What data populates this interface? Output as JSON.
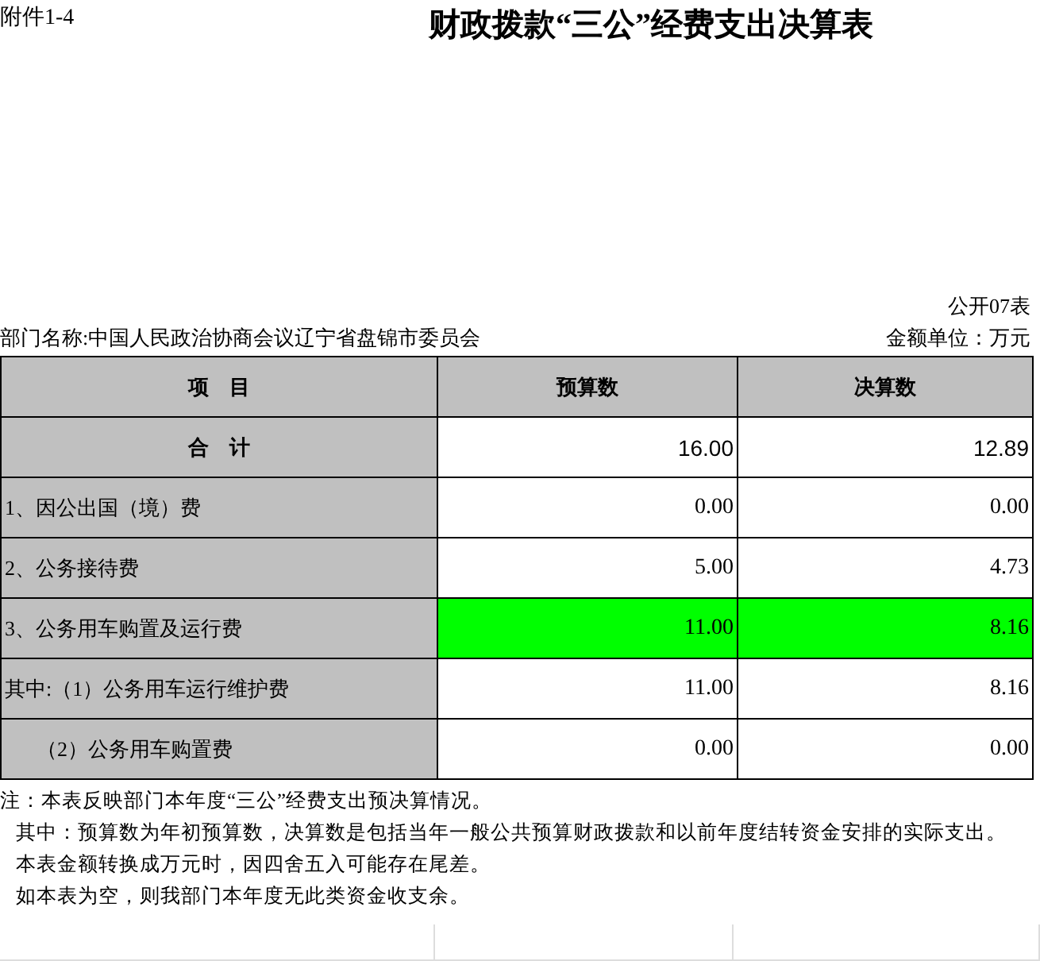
{
  "attachment_label": "附件1-4",
  "title": "财政拨款“三公”经费支出决算表",
  "table_code": "公开07表",
  "department": "部门名称:中国人民政治协商会议辽宁省盘锦市委员会",
  "unit": "金额单位：万元",
  "table": {
    "columns": [
      "项　目",
      "预算数",
      "决算数"
    ],
    "rows": [
      {
        "kind": "total",
        "label": "合　计",
        "budget": "16.00",
        "final": "12.89",
        "highlighted": false
      },
      {
        "kind": "item",
        "label": "1、因公出国（境）费",
        "budget": "0.00",
        "final": "0.00",
        "highlighted": false
      },
      {
        "kind": "item",
        "label": "2、公务接待费",
        "budget": "5.00",
        "final": "4.73",
        "highlighted": false
      },
      {
        "kind": "item",
        "label": "3、公务用车购置及运行费",
        "budget": "11.00",
        "final": "8.16",
        "highlighted": true
      },
      {
        "kind": "item",
        "label": "其中:（1）公务用车运行维护费",
        "budget": "11.00",
        "final": "8.16",
        "highlighted": false
      },
      {
        "kind": "subitem",
        "label": "（2）公务用车购置费",
        "budget": "0.00",
        "final": "0.00",
        "highlighted": false
      }
    ]
  },
  "notes": [
    {
      "kind": "lead",
      "text": "注：本表反映部门本年度“三公”经费支出预决算情况。"
    },
    {
      "kind": "indent",
      "text": "其中：预算数为年初预算数，决算数是包括当年一般公共预算财政拨款和以前年度结转资金安排的实际支出。"
    },
    {
      "kind": "indent",
      "text": "本表金额转换成万元时，因四舍五入可能存在尾差。"
    },
    {
      "kind": "indent",
      "text": "如本表为空，则我部门本年度无此类资金收支余。"
    }
  ]
}
